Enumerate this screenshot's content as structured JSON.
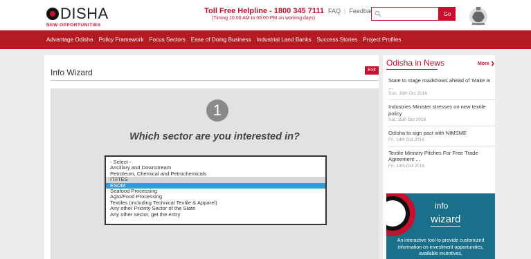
{
  "header": {
    "logo_text": "DISHA",
    "logo_tagline": "NEW OPPORTUNITIES",
    "helpline_title": "Toll Free Helpline - 1800 345 7111",
    "helpline_timing": "(Timing 10.00 AM to 06.00 PM on working days)",
    "faq_label": "FAQ",
    "links_separator": "|",
    "feedback_label": "Feedback",
    "search_value": "",
    "go_label": "Go"
  },
  "nav": {
    "items": [
      "Advantage Odisha",
      "Policy Framework",
      "Focus Sectors",
      "Ease of Doing Business",
      "Industrial Land Banks",
      "Success Stories",
      "Project Profiles"
    ]
  },
  "wizard": {
    "title": "Info Wizard",
    "exit_label": "Exit",
    "step_number": "1",
    "question": "Which sector are you interested in?",
    "options": [
      "- Select -",
      "Ancillary and Downstream",
      "Petroleum, Chemical and Petrochemicals",
      "IT/ITES",
      "ESDM",
      "Seafood Processing",
      "Agro/Food Processing",
      "Textiles (including Technical Textile & Apparel)",
      "Any other Priority Sector of the State",
      "Any other sector, get the entry"
    ],
    "highlighted_option": "ESDM"
  },
  "news": {
    "title": "Odisha in News",
    "more_label": "More ❯",
    "items": [
      {
        "headline": "State to stage roadshows ahead of 'Make in ...",
        "date": "Sun, 16th Oct 2016"
      },
      {
        "headline": "Industries Minister stresses on new textile policy",
        "date": "Sat, 15th Oct 2016"
      },
      {
        "headline": "Odisha to sign pact with NIMSME",
        "date": "Fri, 14th Oct 2016"
      },
      {
        "headline": "Textile Ministry Pitches For Free Trade Agreement ...",
        "date": "Fri, 14th Oct 2016"
      }
    ]
  },
  "banner": {
    "word1": "info",
    "word2": "wizard",
    "text": "An interactive tool to provide customized information on investment opportunities, available incentives,"
  },
  "colors": {
    "brand_red": "#c8102e",
    "nav_red": "#b31a22",
    "select_blue": "#3399dd",
    "banner_teal": "#1a6f8a"
  }
}
